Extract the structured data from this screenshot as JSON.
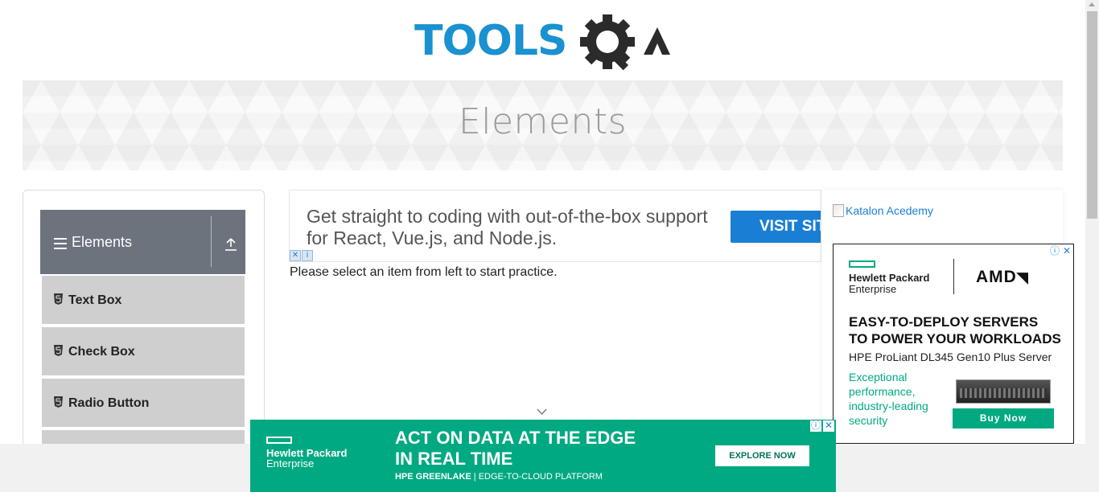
{
  "header": {
    "logo_text": "TOOLSQA",
    "logo_icon": "gear-magnifier-icon"
  },
  "banner": {
    "title": "Elements"
  },
  "sidebar": {
    "group": {
      "title": "Elements",
      "icon": "hamburger-icon",
      "collapse_icon": "upload-arrow-icon"
    },
    "items": [
      {
        "label": "Text Box",
        "icon": "html5-icon"
      },
      {
        "label": "Check Box",
        "icon": "html5-icon"
      },
      {
        "label": "Radio Button",
        "icon": "html5-icon"
      }
    ]
  },
  "top_ad": {
    "text": "Get straight to coding with out-of-the-box support for React, Vue.js, and Node.js.",
    "button": "VISIT SITE"
  },
  "main": {
    "instruction": "Please select an item from left to start practice."
  },
  "right": {
    "katalon_alt": "Katalon Acedemy",
    "side_ad": {
      "brand": "Hewlett Packard",
      "brand_line2": "Enterprise",
      "partner": "AMD",
      "headline_1": "EASY-TO-DEPLOY SERVERS",
      "headline_2": "TO POWER YOUR WORKLOADS",
      "product": "HPE ProLiant DL345 Gen10 Plus Server",
      "tagline": "Exceptional performance, industry-leading security",
      "button": "Buy Now"
    }
  },
  "bottom_ad": {
    "brand": "Hewlett Packard",
    "brand_line2": "Enterprise",
    "headline_1": "ACT ON DATA AT THE EDGE",
    "headline_2": "IN REAL TIME",
    "sub_bold": "HPE GREENLAKE",
    "sub_rest": " | EDGE-TO-CLOUD PLATFORM",
    "button": "EXPLORE NOW"
  },
  "colors": {
    "brand_blue": "#1a91d0",
    "hpe_green": "#01a982",
    "menu_header": "#6c737c",
    "menu_item": "#cfcfcf"
  }
}
